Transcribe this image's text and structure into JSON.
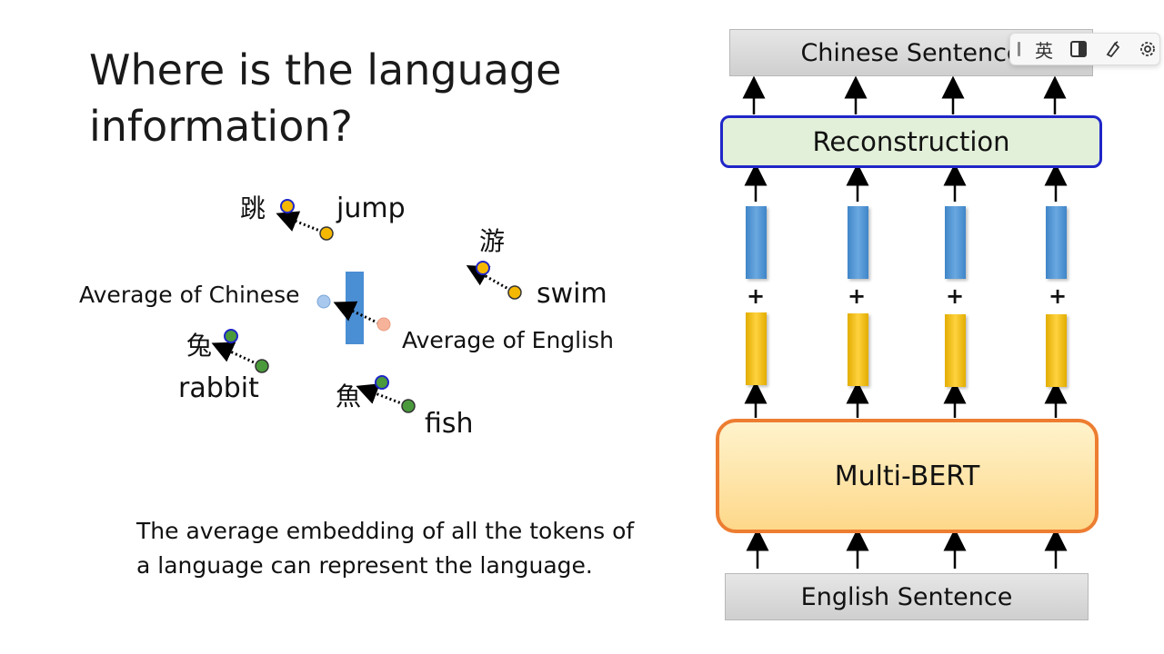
{
  "slide": {
    "title_line1": "Where is the language",
    "title_line2": "information?",
    "caption_line1": "The average embedding of all the tokens of",
    "caption_line2": "a language can represent the language."
  },
  "embedding_plot": {
    "labels": {
      "tiao": "跳",
      "jump": "jump",
      "you": "游",
      "swim": "swim",
      "avg_chinese": "Average of Chinese",
      "avg_english": "Average of English",
      "tu": "兔",
      "rabbit": "rabbit",
      "yu": "魚",
      "fish": "fish"
    },
    "colors": {
      "english_point": "#f5b800",
      "chinese_point_outline": "#1f26c8",
      "green_point": "#4a9a3c",
      "avg_chinese_point": "#a9c8ee",
      "avg_english_point": "#f7b39a",
      "vector": "#4a8ed4"
    }
  },
  "architecture": {
    "top_sentence": "Chinese Sentence",
    "reconstruction": "Reconstruction",
    "model": "Multi-BERT",
    "bottom_sentence": "English Sentence",
    "plus": "+",
    "colors": {
      "reconstruction_border": "#1f26c8",
      "reconstruction_fill": "#e2efd9",
      "model_border": "#ed7d31",
      "blue_vector": "#4a8ed4",
      "gold_vector": "#f5c000"
    }
  },
  "toolbar": {
    "ime_label": "英",
    "icons": [
      "grip-icon",
      "ime-english-icon",
      "half-width-icon",
      "skin-icon",
      "settings-icon"
    ]
  },
  "cursor": {
    "color": "#e0232b"
  }
}
